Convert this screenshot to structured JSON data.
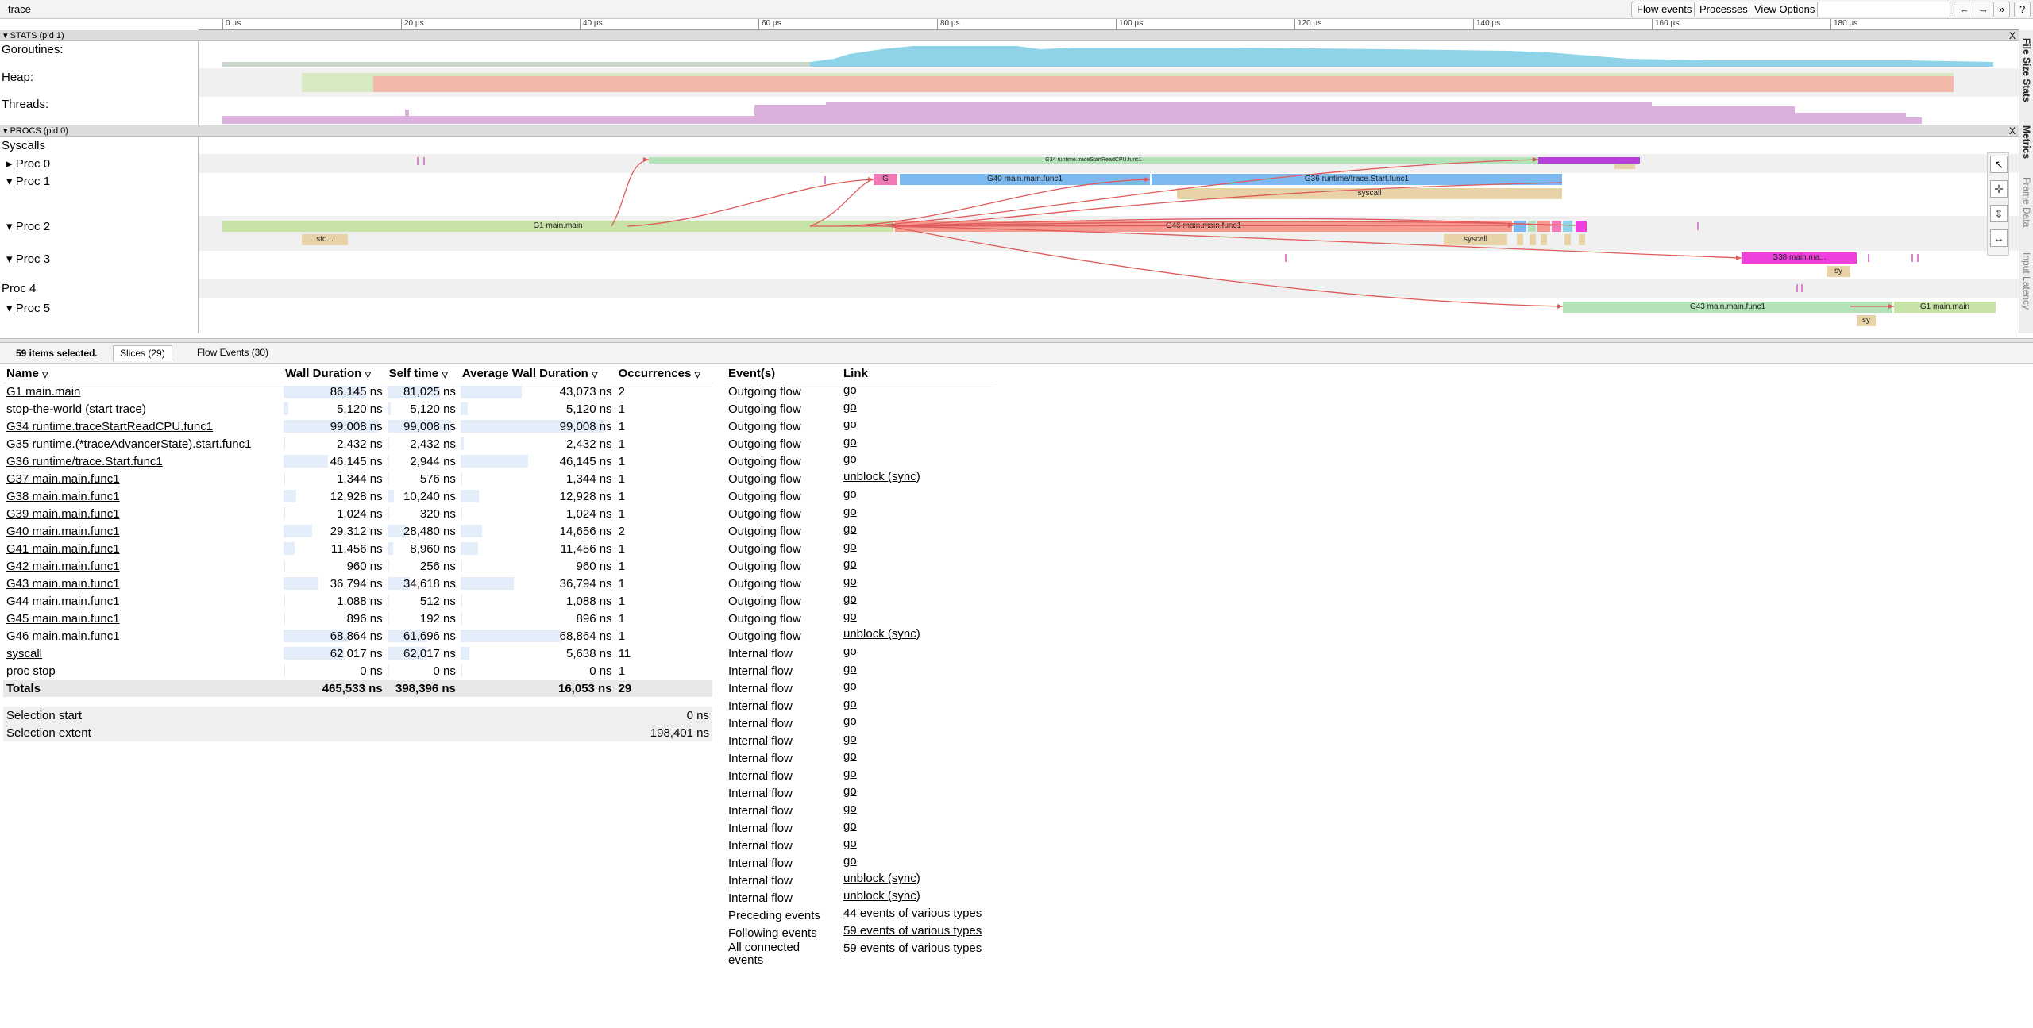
{
  "window_title": "trace",
  "toolbar": {
    "flow_events": "Flow events",
    "processes": "Processes",
    "view_options": "View Options",
    "nav_back": "←",
    "nav_fwd": "→",
    "nav_more": "»",
    "help": "?"
  },
  "ruler": [
    "0 µs",
    "20 µs",
    "40 µs",
    "60 µs",
    "80 µs",
    "100 µs",
    "120 µs",
    "140 µs",
    "160 µs",
    "180 µs"
  ],
  "stats": {
    "header": "STATS (pid 1)",
    "close": "X",
    "rows": [
      "Goroutines:",
      "Heap:",
      "Threads:"
    ]
  },
  "procs": {
    "header": "PROCS (pid 0)",
    "close": "X",
    "rows": [
      "Syscalls",
      "Proc 0",
      "Proc 1",
      "Proc 2",
      "Proc 3",
      "Proc 4",
      "Proc 5"
    ]
  },
  "slices": {
    "g34": "G34 runtime.traceStartReadCPU.func1",
    "g_small": "G",
    "g40": "G40 main.main.func1",
    "g36": "G36 runtime/trace.Start.func1",
    "syscall1": "syscall",
    "g1": "G1 main.main",
    "sto": "sto...",
    "g46": "G46 main.main.func1",
    "syscall2": "syscall",
    "g38": "G38 main.ma...",
    "sy1": "sy",
    "g43": "G43 main.main.func1",
    "g1b": "G1 main.main",
    "sy2": "sy"
  },
  "side_tabs": [
    "File Size Stats",
    "Metrics",
    "Frame Data",
    "Input Latency"
  ],
  "colors": {
    "green": "#b4e2b8",
    "blue": "#7bb9f0",
    "salmon": "#f49a90",
    "tan": "#e8d3a8",
    "pink": "#f07ab5",
    "magenta": "#ef40dc",
    "purple": "#b53fd9",
    "light_green": "#c7e3a7"
  },
  "bottom": {
    "selected": "59 items selected.",
    "tab_slices": "Slices (29)",
    "tab_flow": "Flow Events (30)"
  },
  "slices_table": {
    "headers": [
      "Name",
      "Wall Duration",
      "Self time",
      "Average Wall Duration",
      "Occurrences"
    ],
    "rows": [
      {
        "name": "G1 main.main",
        "wall": "86,145 ns",
        "self": "81,025 ns",
        "avg": "43,073 ns",
        "occ": "2",
        "w": 0.87,
        "s": 0.82,
        "a": 0.43
      },
      {
        "name": "stop-the-world (start trace)",
        "wall": "5,120 ns",
        "self": "5,120 ns",
        "avg": "5,120 ns",
        "occ": "1",
        "w": 0.05,
        "s": 0.05,
        "a": 0.05
      },
      {
        "name": "G34 runtime.traceStartReadCPU.func1",
        "wall": "99,008 ns",
        "self": "99,008 ns",
        "avg": "99,008 ns",
        "occ": "1",
        "w": 1.0,
        "s": 1.0,
        "a": 1.0
      },
      {
        "name": "G35 runtime.(*traceAdvancerState).start.func1",
        "wall": "2,432 ns",
        "self": "2,432 ns",
        "avg": "2,432 ns",
        "occ": "1",
        "w": 0.02,
        "s": 0.02,
        "a": 0.02
      },
      {
        "name": "G36 runtime/trace.Start.func1",
        "wall": "46,145 ns",
        "self": "2,944 ns",
        "avg": "46,145 ns",
        "occ": "1",
        "w": 0.47,
        "s": 0.03,
        "a": 0.47
      },
      {
        "name": "G37 main.main.func1",
        "wall": "1,344 ns",
        "self": "576 ns",
        "avg": "1,344 ns",
        "occ": "1",
        "w": 0.01,
        "s": 0.01,
        "a": 0.01
      },
      {
        "name": "G38 main.main.func1",
        "wall": "12,928 ns",
        "self": "10,240 ns",
        "avg": "12,928 ns",
        "occ": "1",
        "w": 0.13,
        "s": 0.1,
        "a": 0.13
      },
      {
        "name": "G39 main.main.func1",
        "wall": "1,024 ns",
        "self": "320 ns",
        "avg": "1,024 ns",
        "occ": "1",
        "w": 0.01,
        "s": 0.0,
        "a": 0.01
      },
      {
        "name": "G40 main.main.func1",
        "wall": "29,312 ns",
        "self": "28,480 ns",
        "avg": "14,656 ns",
        "occ": "2",
        "w": 0.3,
        "s": 0.29,
        "a": 0.15
      },
      {
        "name": "G41 main.main.func1",
        "wall": "11,456 ns",
        "self": "8,960 ns",
        "avg": "11,456 ns",
        "occ": "1",
        "w": 0.12,
        "s": 0.09,
        "a": 0.12
      },
      {
        "name": "G42 main.main.func1",
        "wall": "960 ns",
        "self": "256 ns",
        "avg": "960 ns",
        "occ": "1",
        "w": 0.01,
        "s": 0.0,
        "a": 0.01
      },
      {
        "name": "G43 main.main.func1",
        "wall": "36,794 ns",
        "self": "34,618 ns",
        "avg": "36,794 ns",
        "occ": "1",
        "w": 0.37,
        "s": 0.35,
        "a": 0.37
      },
      {
        "name": "G44 main.main.func1",
        "wall": "1,088 ns",
        "self": "512 ns",
        "avg": "1,088 ns",
        "occ": "1",
        "w": 0.01,
        "s": 0.01,
        "a": 0.01
      },
      {
        "name": "G45 main.main.func1",
        "wall": "896 ns",
        "self": "192 ns",
        "avg": "896 ns",
        "occ": "1",
        "w": 0.01,
        "s": 0.0,
        "a": 0.01
      },
      {
        "name": "G46 main.main.func1",
        "wall": "68,864 ns",
        "self": "61,696 ns",
        "avg": "68,864 ns",
        "occ": "1",
        "w": 0.7,
        "s": 0.62,
        "a": 0.7
      },
      {
        "name": "syscall",
        "wall": "62,017 ns",
        "self": "62,017 ns",
        "avg": "5,638 ns",
        "occ": "11",
        "w": 0.63,
        "s": 0.63,
        "a": 0.06
      },
      {
        "name": "proc stop",
        "wall": "0 ns",
        "self": "0 ns",
        "avg": "0 ns",
        "occ": "1",
        "w": 0.0,
        "s": 0.0,
        "a": 0.0
      }
    ],
    "totals": {
      "label": "Totals",
      "wall": "465,533 ns",
      "self": "398,396 ns",
      "avg": "16,053 ns",
      "occ": "29"
    },
    "selection_start_label": "Selection start",
    "selection_start": "0 ns",
    "selection_extent_label": "Selection extent",
    "selection_extent": "198,401 ns"
  },
  "events_table": {
    "headers": [
      "Event(s)",
      "Link"
    ],
    "rows": [
      {
        "event": "Outgoing flow",
        "link": "go"
      },
      {
        "event": "Outgoing flow",
        "link": "go"
      },
      {
        "event": "Outgoing flow",
        "link": "go"
      },
      {
        "event": "Outgoing flow",
        "link": "go"
      },
      {
        "event": "Outgoing flow",
        "link": "go"
      },
      {
        "event": "Outgoing flow",
        "link": "unblock (sync)"
      },
      {
        "event": "Outgoing flow",
        "link": "go"
      },
      {
        "event": "Outgoing flow",
        "link": "go"
      },
      {
        "event": "Outgoing flow",
        "link": "go"
      },
      {
        "event": "Outgoing flow",
        "link": "go"
      },
      {
        "event": "Outgoing flow",
        "link": "go"
      },
      {
        "event": "Outgoing flow",
        "link": "go"
      },
      {
        "event": "Outgoing flow",
        "link": "go"
      },
      {
        "event": "Outgoing flow",
        "link": "go"
      },
      {
        "event": "Outgoing flow",
        "link": "unblock (sync)"
      },
      {
        "event": "Internal flow",
        "link": "go"
      },
      {
        "event": "Internal flow",
        "link": "go"
      },
      {
        "event": "Internal flow",
        "link": "go"
      },
      {
        "event": "Internal flow",
        "link": "go"
      },
      {
        "event": "Internal flow",
        "link": "go"
      },
      {
        "event": "Internal flow",
        "link": "go"
      },
      {
        "event": "Internal flow",
        "link": "go"
      },
      {
        "event": "Internal flow",
        "link": "go"
      },
      {
        "event": "Internal flow",
        "link": "go"
      },
      {
        "event": "Internal flow",
        "link": "go"
      },
      {
        "event": "Internal flow",
        "link": "go"
      },
      {
        "event": "Internal flow",
        "link": "go"
      },
      {
        "event": "Internal flow",
        "link": "go"
      },
      {
        "event": "Internal flow",
        "link": "unblock (sync)"
      },
      {
        "event": "Internal flow",
        "link": "unblock (sync)"
      },
      {
        "event": "Preceding events",
        "link": "44 events of various types"
      },
      {
        "event": "Following events",
        "link": "59 events of various types"
      },
      {
        "event": "All connected events",
        "link": "59 events of various types"
      }
    ]
  }
}
